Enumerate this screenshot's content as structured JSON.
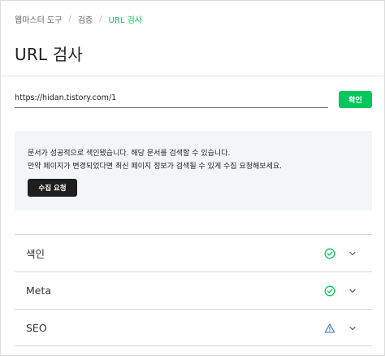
{
  "breadcrumb": {
    "items": [
      "웹마스터 도구",
      "검증"
    ],
    "separator": "/",
    "current": "URL 검사"
  },
  "page": {
    "title": "URL 검사"
  },
  "search": {
    "url_value": "https://hidan.tistory.com/1",
    "confirm_label": "확인"
  },
  "info": {
    "line1": "문서가 성공적으로 색인됐습니다. 해당 문서를 검색할 수 있습니다.",
    "line2": "만약 페이지가 변경되었다면 최신 페이지 정보가 검색될 수 있게 수집 요청해보세요.",
    "collect_label": "수집 요청"
  },
  "sections": [
    {
      "label": "색인",
      "status": "ok",
      "icon": "check-circle-icon"
    },
    {
      "label": "Meta",
      "status": "ok",
      "icon": "check-circle-icon"
    },
    {
      "label": "SEO",
      "status": "warning",
      "icon": "warning-triangle-icon"
    }
  ],
  "colors": {
    "accent": "#03c75a",
    "warning": "#4a7fd4",
    "info_bg": "#f2f6f9",
    "dark_button": "#1e1e1e"
  }
}
